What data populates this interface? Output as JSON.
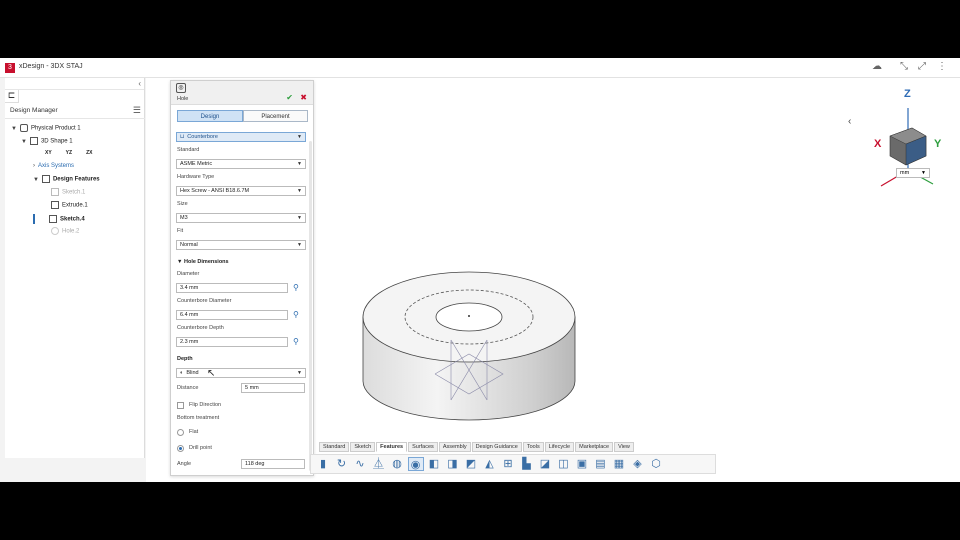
{
  "app": {
    "title": "xDesign - 3DX STAJ",
    "logo": "3DS"
  },
  "window_controls": [
    "cloud-icon",
    "restore-icon",
    "expand-icon",
    "menu-icon"
  ],
  "design_manager": {
    "title": "Design Manager",
    "tree": [
      {
        "label": "Physical Product 1",
        "level": 0
      },
      {
        "label": "3D Shape 1",
        "level": 1
      },
      {
        "label": "Axis Systems",
        "level": 2
      },
      {
        "label": "Design Features",
        "level": 2
      },
      {
        "label": "Sketch.1",
        "level": 3
      },
      {
        "label": "Extrude.1",
        "level": 3
      },
      {
        "label": "Sketch.4",
        "level": 3
      },
      {
        "label": "Hole.2",
        "level": 3
      }
    ],
    "plane_icons": [
      "XY",
      "YZ",
      "ZX"
    ]
  },
  "hole_dialog": {
    "title": "Hole",
    "tabs": {
      "design": "Design",
      "placement": "Placement"
    },
    "hole_type": "Counterbore",
    "standard_label": "Standard",
    "standard_value": "ASME Metric",
    "hardware_label": "Hardware Type",
    "hardware_value": "Hex Screw - ANSI B18.6.7M",
    "size_label": "Size",
    "size_value": "M3",
    "fit_label": "Fit",
    "fit_value": "Normal",
    "dimensions_section": "Hole Dimensions",
    "diameter_label": "Diameter",
    "diameter_value": "3.4 mm",
    "cb_diameter_label": "Counterbore Diameter",
    "cb_diameter_value": "6.4 mm",
    "cb_depth_label": "Counterbore Depth",
    "cb_depth_value": "2.3 mm",
    "depth_section": "Depth",
    "depth_type": "Blind",
    "distance_label": "Distance",
    "distance_value": "5 mm",
    "flip_label": "Flip Direction",
    "bottom_label": "Bottom treatment",
    "flat_label": "Flat",
    "drill_label": "Drill point",
    "angle_label": "Angle",
    "angle_value": "118 deg"
  },
  "ribbon_tabs": [
    "Standard",
    "Sketch",
    "Features",
    "Surfaces",
    "Assembly",
    "Design Guidance",
    "Tools",
    "Lifecycle",
    "Marketplace",
    "View"
  ],
  "active_ribbon_tab": "Features",
  "toolbar_icons": [
    "extrude-icon",
    "revolve-icon",
    "sweep-icon",
    "loft-icon",
    "hole-icon",
    "fillet-icon",
    "chamfer-icon",
    "shell-icon",
    "draft-icon",
    "mirror-icon",
    "pattern-icon",
    "rib-icon",
    "split-icon",
    "boolean-icon",
    "thicken-icon",
    "offset-icon",
    "replace-icon",
    "thread-icon",
    "more-icon"
  ],
  "compass": {
    "x": "X",
    "y": "Y",
    "z": "Z"
  },
  "unit_selector": "mm",
  "colors": {
    "accent": "#2b6cb0",
    "brand": "#c8102e",
    "ok": "#2e9e3e"
  }
}
